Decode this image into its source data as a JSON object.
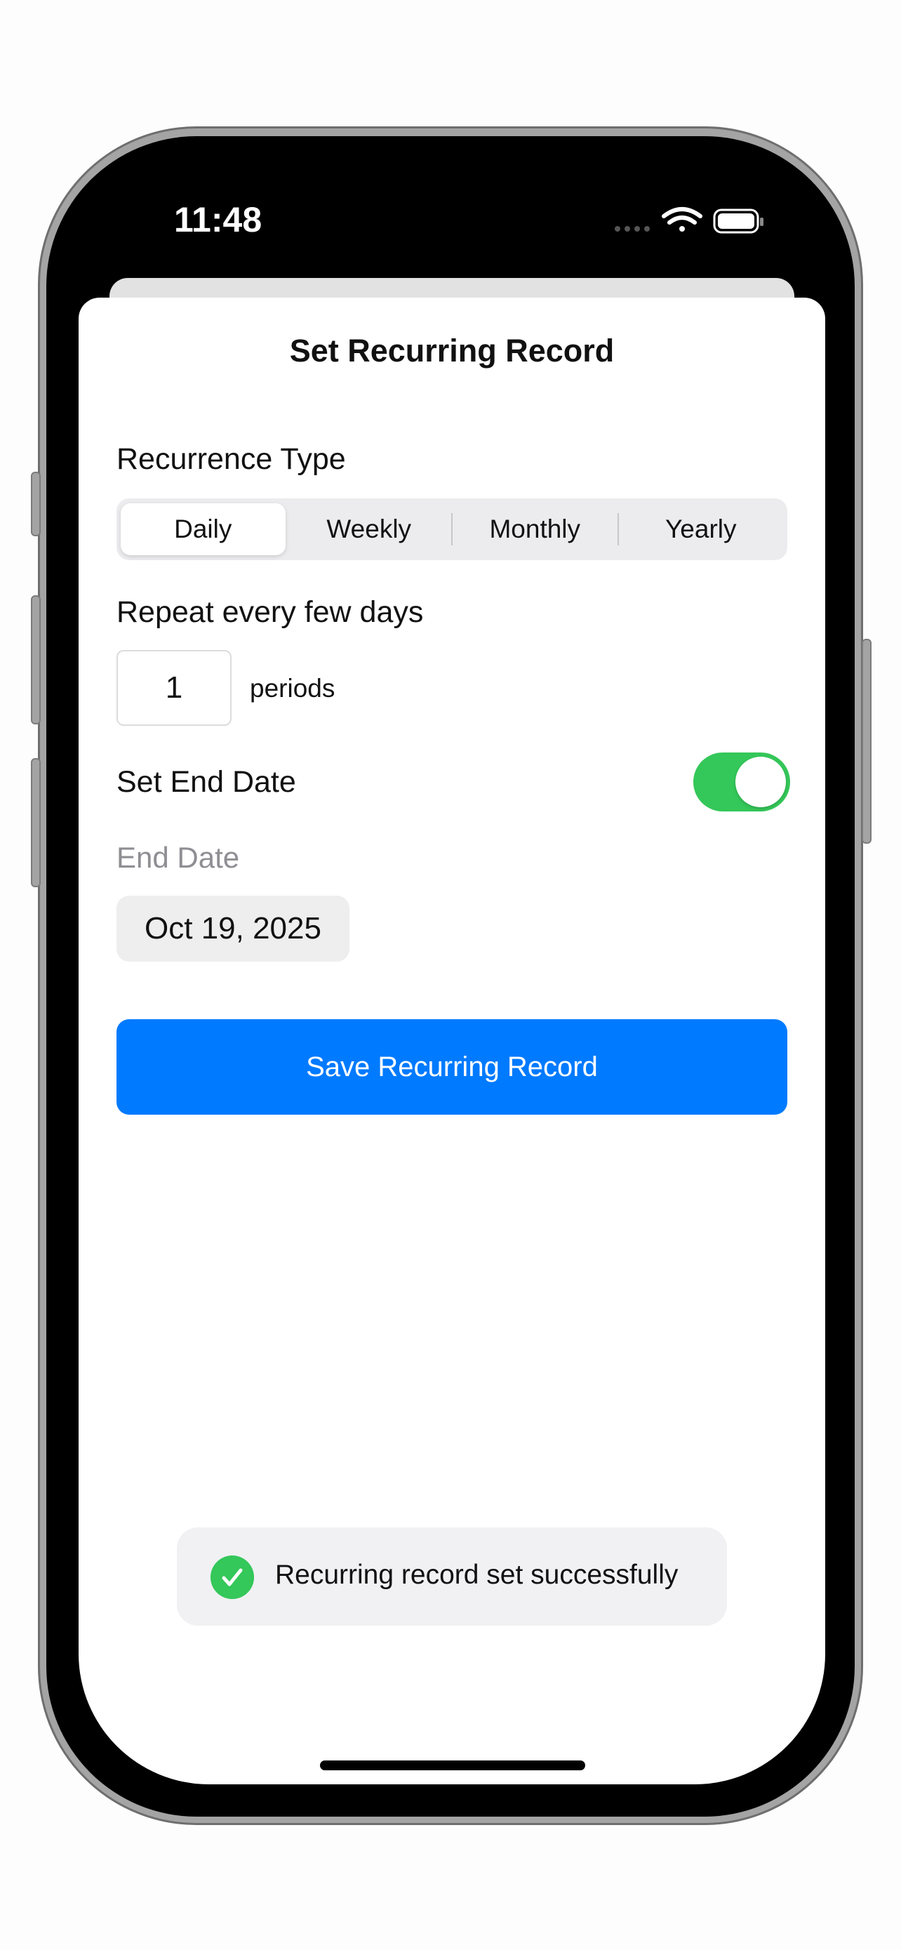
{
  "status_bar": {
    "time": "11:48",
    "icons": [
      "signal-dots-icon",
      "wifi-icon",
      "battery-icon"
    ]
  },
  "sheet": {
    "title": "Set Recurring Record"
  },
  "recurrence": {
    "label": "Recurrence Type",
    "segments": [
      "Daily",
      "Weekly",
      "Monthly",
      "Yearly"
    ],
    "selected": "Daily"
  },
  "repeat": {
    "label": "Repeat every few days",
    "value": "1",
    "unit": "periods"
  },
  "end_date": {
    "toggle_label": "Set End Date",
    "toggle_on": true,
    "field_label": "End Date",
    "value": "Oct 19, 2025"
  },
  "save_button": {
    "label": "Save Recurring Record"
  },
  "toast": {
    "message": "Recurring record set successfully"
  },
  "colors": {
    "accent": "#007aff",
    "toggle_on": "#34c759",
    "success": "#34c759"
  }
}
